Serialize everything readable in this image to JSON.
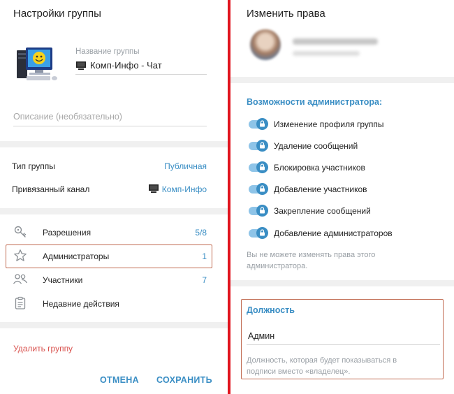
{
  "left": {
    "title": "Настройки группы",
    "group_name_label": "Название группы",
    "group_name_value": "Комп-Инфо - Чат",
    "description_placeholder": "Описание (необязательно)",
    "group_type_label": "Тип группы",
    "group_type_value": "Публичная",
    "linked_channel_label": "Привязанный канал",
    "linked_channel_value": "Комп-Инфо",
    "menu": [
      {
        "label": "Разрешения",
        "value": "5/8",
        "icon": "key-icon"
      },
      {
        "label": "Администраторы",
        "value": "1",
        "icon": "star-icon"
      },
      {
        "label": "Участники",
        "value": "7",
        "icon": "people-icon"
      },
      {
        "label": "Недавние действия",
        "value": "",
        "icon": "clipboard-icon"
      }
    ],
    "delete_group": "Удалить группу",
    "cancel": "ОТМЕНА",
    "save": "СОХРАНИТЬ"
  },
  "right": {
    "title": "Изменить права",
    "section_title": "Возможности администратора:",
    "permissions": [
      {
        "label": "Изменение профиля группы",
        "enabled": true
      },
      {
        "label": "Удаление сообщений",
        "enabled": true
      },
      {
        "label": "Блокировка участников",
        "enabled": true
      },
      {
        "label": "Добавление участников",
        "enabled": true
      },
      {
        "label": "Закрепление сообщений",
        "enabled": true
      },
      {
        "label": "Добавление администраторов",
        "enabled": true
      }
    ],
    "note": "Вы не можете изменять права этого администратора.",
    "position_title": "Должность",
    "position_value": "Админ",
    "position_hint": "Должность, которая будет показываться в подписи вместо «владелец»."
  },
  "colors": {
    "accent": "#3a8ec4",
    "danger": "#d9534f",
    "highlight_border": "#c06a50",
    "divider": "#e0141e"
  }
}
